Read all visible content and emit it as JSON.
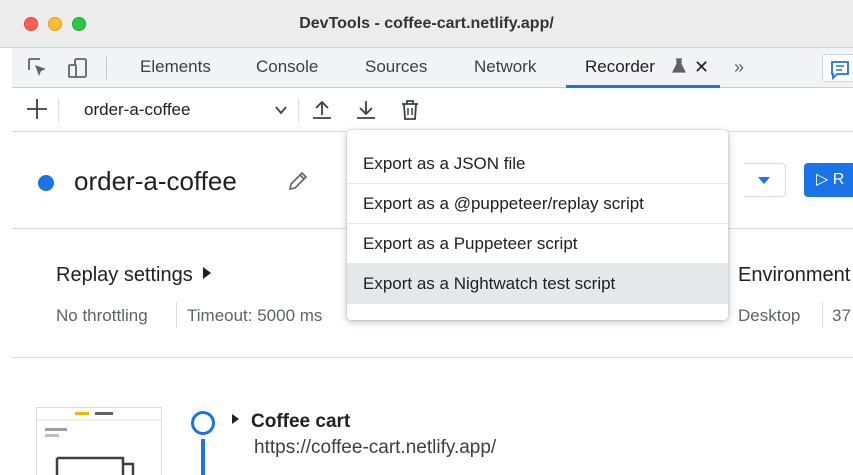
{
  "window": {
    "title": "DevTools - coffee-cart.netlify.app/"
  },
  "tabs": [
    {
      "label": "Elements"
    },
    {
      "label": "Console"
    },
    {
      "label": "Sources"
    },
    {
      "label": "Network"
    },
    {
      "label": "Recorder",
      "active": true
    }
  ],
  "toolbar": {
    "inspect_icon": "cursor-select-icon",
    "device_icon": "device-toggle-icon",
    "more_tabs": "»",
    "close_tab": "✕"
  },
  "recorder_toolbar": {
    "selected_recording": "order-a-coffee",
    "icons": [
      "plus-icon",
      "export-upload-icon",
      "import-download-icon",
      "trash-icon"
    ]
  },
  "recording": {
    "title": "order-a-coffee",
    "replay_button_label": "▷ R"
  },
  "settings": {
    "replay_title": "Replay settings",
    "throttling": "No throttling",
    "timeout": "Timeout: 5000 ms",
    "environment_title": "Environment",
    "device": "Desktop",
    "width_partial": "37"
  },
  "export_menu": {
    "items": [
      {
        "label": "Export as a JSON file"
      },
      {
        "label": "Export as a @puppeteer/replay script"
      },
      {
        "label": "Export as a Puppeteer script"
      },
      {
        "label": "Export as a Nightwatch test script",
        "hovered": true
      }
    ]
  },
  "steps": [
    {
      "title": "Coffee cart",
      "url": "https://coffee-cart.netlify.app/"
    }
  ],
  "colors": {
    "accent": "#1a73e8",
    "hover": "#e6e7e9"
  }
}
